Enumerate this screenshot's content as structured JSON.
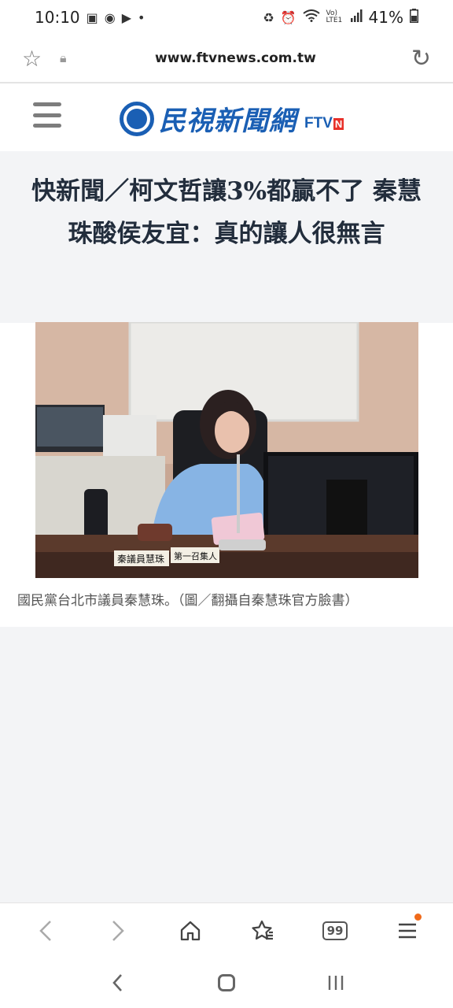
{
  "status_bar": {
    "time": "10:10",
    "battery": "41%",
    "left_icons": [
      "gallery-icon",
      "chrome-like-icon",
      "youtube-icon",
      "dot-icon"
    ],
    "right_icons": [
      "recycle-icon",
      "alarm-icon",
      "wifi-icon",
      "volte-icon",
      "signal-icon",
      "battery-icon"
    ],
    "volte_text": "Vo) LTE1"
  },
  "browser": {
    "url": "www.ftvnews.com.tw"
  },
  "site": {
    "logo_text": "民視新聞網",
    "logo_sub": "FTV",
    "logo_badge": "N",
    "brand_color": "#1a5fb4"
  },
  "article": {
    "title": "快新聞／柯文哲讓3%都贏不了 秦慧珠酸侯友宜：真的讓人很無言",
    "photo_desc_sign1": "秦議員慧珠",
    "photo_desc_sign2": "第一召集人",
    "caption": "國民黨台北市議員秦慧珠。（圖／翻攝自秦慧珠官方臉書）"
  },
  "bottom_nav": {
    "tab_count": "99",
    "items": [
      "back-icon",
      "forward-icon",
      "home-icon",
      "bookmarks-icon",
      "tabs-icon",
      "menu-icon"
    ]
  },
  "system_nav": {
    "items": [
      "back-nav-icon",
      "home-nav-icon",
      "recents-icon"
    ]
  }
}
